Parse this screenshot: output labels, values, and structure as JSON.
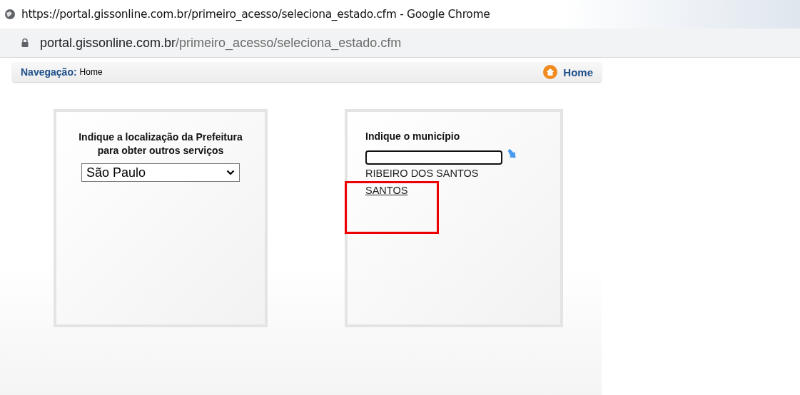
{
  "window": {
    "title": "https://portal.gissonline.com.br/primeiro_acesso/seleciona_estado.cfm - Google Chrome"
  },
  "address_bar": {
    "host": "portal.gissonline.com.br",
    "path": "/primeiro_acesso/seleciona_estado.cfm"
  },
  "navigation": {
    "label": "Navegação:",
    "crumb": "Home",
    "home_link": "Home"
  },
  "state_panel": {
    "prompt": "Indique a localização da Prefeitura para obter outros serviços",
    "select_value": "São Paulo"
  },
  "city_panel": {
    "prompt": "Indique o município",
    "suggestions": [
      {
        "label": "RIBEIRO DOS SANTOS",
        "selected": false
      },
      {
        "label": "SANTOS",
        "selected": true
      }
    ]
  }
}
